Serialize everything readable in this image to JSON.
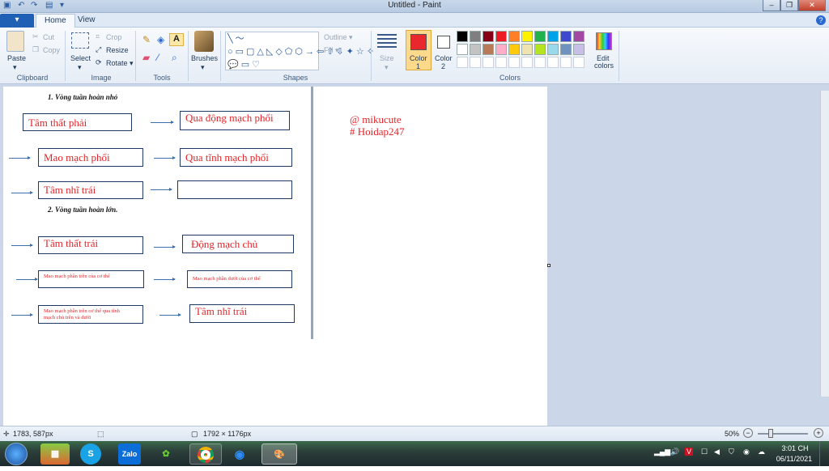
{
  "window": {
    "title": "Untitled - Paint",
    "minimize": "‒",
    "restore": "❐",
    "close": "✕"
  },
  "tabs": {
    "file": "▾",
    "home": "Home",
    "view": "View"
  },
  "ribbon": {
    "clipboard": {
      "paste": "Paste",
      "cut": "Cut",
      "copy": "Copy",
      "label": "Clipboard"
    },
    "image": {
      "select": "Select",
      "crop": "Crop",
      "resize": "Resize",
      "rotate": "Rotate ▾",
      "label": "Image"
    },
    "tools": {
      "label": "Tools",
      "text_tool": "A"
    },
    "brushes": {
      "label": "Brushes"
    },
    "shapes": {
      "label": "Shapes",
      "outline": "Outline ▾",
      "fill": "Fill ▾"
    },
    "size": {
      "label": "Size"
    },
    "color1": {
      "label": "Color",
      "num": "1",
      "color": "#e8282c"
    },
    "color2": {
      "label": "Color",
      "num": "2",
      "color": "#ffffff"
    },
    "colors": {
      "label": "Colors",
      "edit": "Edit",
      "edit2": "colors",
      "palette_row1": [
        "#000000",
        "#7f7f7f",
        "#880015",
        "#ed1c24",
        "#ff7f27",
        "#fff200",
        "#22b14c",
        "#00a2e8",
        "#3f48cc",
        "#a349a4"
      ],
      "palette_row2": [
        "#ffffff",
        "#c3c3c3",
        "#b97a57",
        "#ffaec9",
        "#ffc90e",
        "#efe4b0",
        "#b5e61d",
        "#99d9ea",
        "#7092be",
        "#c8bfe7"
      ]
    }
  },
  "canvas": {
    "heading1": "1.  Vòng tuần hoàn nhỏ",
    "heading2": "2.  Vòng tuần hoàn lớn.",
    "box1": "Tâm thất phải",
    "box2": "Qua động mạch phổi",
    "box3": "Mao mạch phổi",
    "box4": "Qua tĩnh mạch phổi",
    "box5": "Tâm nhĩ trái",
    "box6": "",
    "box7": "Tâm thất trái",
    "box8": "Động mạch chủ",
    "box9": "Mao mạch phần trên của cơ thể",
    "box10": "Mao mạch phần dưới của cơ thể",
    "box11a": "Mao mạch phần trên cơ thể qua tĩnh",
    "box11b": "mạch chủ trên và dưới",
    "box12": "Tâm nhĩ trái",
    "note1": "@ mikucute",
    "note2": "# Hoidap247"
  },
  "status": {
    "cursor": "1783, 587px",
    "size": "1792 × 1176px",
    "zoom": "50%"
  },
  "taskbar": {
    "time": "3:01 CH",
    "date": "06/11/2021"
  }
}
